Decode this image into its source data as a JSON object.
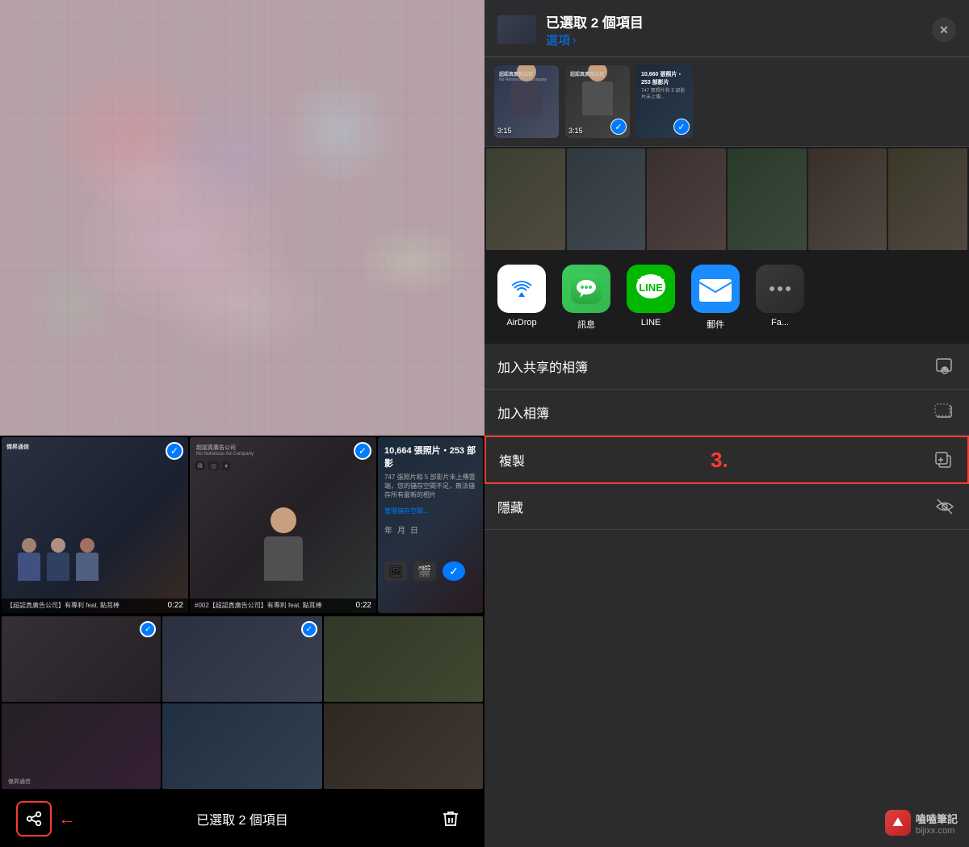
{
  "left": {
    "toolbar": {
      "title": "已選取 2 個項目",
      "share_label": "分享",
      "delete_label": "刪除"
    },
    "videos": [
      {
        "title": "【超認真廣告公司】有專利 feat. 點耳棒",
        "time": "0:22",
        "selected": false
      },
      {
        "title": "#002【超認真廣告公司】有專利 feat. 點耳棒",
        "time": "0:22",
        "selected": true
      }
    ]
  },
  "right": {
    "header": {
      "title": "已選取 2 個項目",
      "subtitle": "選項",
      "close_label": "✕"
    },
    "preview": {
      "items": [
        {
          "time": "3:15",
          "checked": false
        },
        {
          "time": "3:15",
          "checked": true
        },
        {
          "time": "",
          "checked": true
        }
      ]
    },
    "storage_info": {
      "count": "10,660 張照片・253 部影片",
      "warning": "747 張照片和 5 部影片未上傳雲端，您的儲存空間不足，無法儲存所有最新的相片",
      "action": "管理儲存空間或啟用 iCloud..."
    },
    "app_icons": [
      {
        "id": "airdrop",
        "label": "AirDrop",
        "type": "airdrop"
      },
      {
        "id": "messages",
        "label": "訊息",
        "type": "messages"
      },
      {
        "id": "line",
        "label": "LINE",
        "type": "line"
      },
      {
        "id": "mail",
        "label": "郵件",
        "type": "mail"
      },
      {
        "id": "more",
        "label": "Fa...",
        "type": "more"
      }
    ],
    "actions": [
      {
        "id": "add-shared-album",
        "label": "加入共享的相簿",
        "icon": "shared-album-icon",
        "highlighted": false
      },
      {
        "id": "add-album",
        "label": "加入相簿",
        "icon": "album-icon",
        "highlighted": false
      },
      {
        "id": "copy",
        "label": "複製",
        "icon": "copy-icon",
        "highlighted": true,
        "number": "3."
      },
      {
        "id": "hide",
        "label": "隱藏",
        "icon": "hide-icon",
        "highlighted": false
      }
    ]
  },
  "brand": {
    "name": "嗑嗑筆記",
    "site": "bijixx.com"
  }
}
